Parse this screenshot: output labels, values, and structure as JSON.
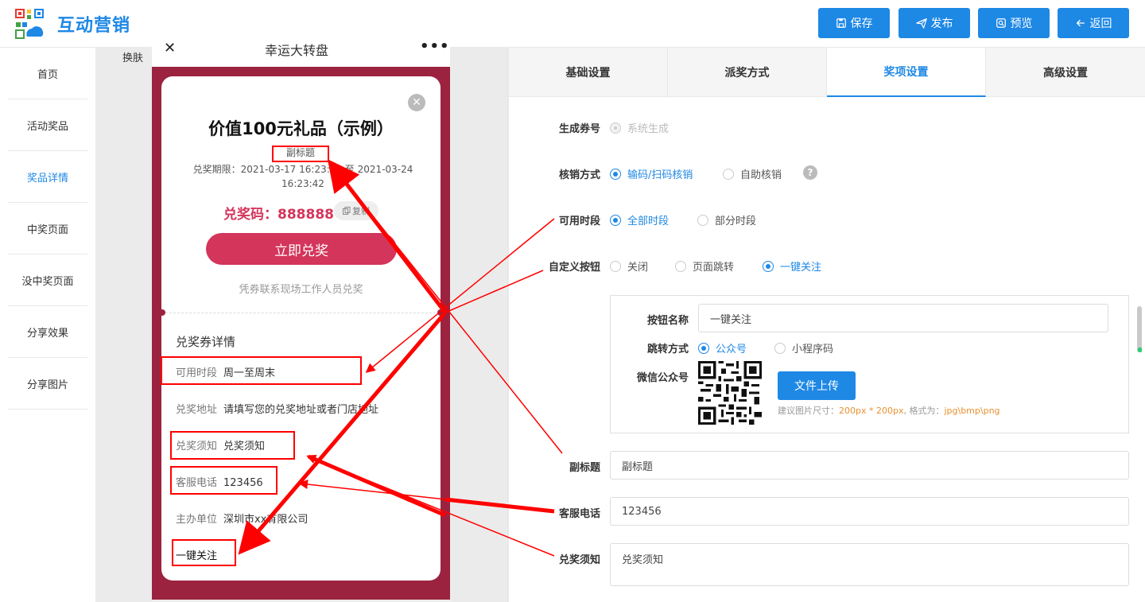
{
  "header": {
    "brand": "互动营销",
    "buttons": [
      {
        "label": "保存",
        "icon": "save-icon"
      },
      {
        "label": "发布",
        "icon": "send-icon"
      },
      {
        "label": "预览",
        "icon": "preview-icon"
      },
      {
        "label": "返回",
        "icon": "arrow-left-icon"
      }
    ]
  },
  "sidebar": {
    "items": [
      {
        "label": "首页"
      },
      {
        "label": "活动奖品"
      },
      {
        "label": "奖品详情",
        "active": true
      },
      {
        "label": "中奖页面"
      },
      {
        "label": "没中奖页面"
      },
      {
        "label": "分享效果"
      },
      {
        "label": "分享图片"
      }
    ]
  },
  "preview": {
    "skin_label": "换肤",
    "phone_title": "幸运大转盘",
    "close_glyph": "✕",
    "more_glyph": "•••",
    "card": {
      "close_glyph": "✕",
      "title": "价值100元礼品（示例）",
      "subtitle": "副标题",
      "period": "兑奖期限：2021-03-17 16:23:42 至 2021-03-24 16:23:42",
      "code_label": "兑奖码：888888",
      "copy_label": "复制",
      "redeem_button": "立即兑奖",
      "redeem_note": "凭券联系现场工作人员兑奖",
      "detail_title": "兑奖券详情",
      "details": [
        {
          "key": "可用时段",
          "value": "周一至周末"
        },
        {
          "key": "兑奖地址",
          "value": "请填写您的兑奖地址或者门店地址"
        },
        {
          "key": "兑奖须知",
          "value": "兑奖须知"
        },
        {
          "key": "客服电话",
          "value": "123456"
        },
        {
          "key": "主办单位",
          "value": "深圳市xx有限公司"
        }
      ],
      "follow_button": "一键关注"
    }
  },
  "tabs": [
    {
      "label": "基础设置"
    },
    {
      "label": "派奖方式"
    },
    {
      "label": "奖项设置",
      "active": true
    },
    {
      "label": "高级设置"
    }
  ],
  "form": {
    "coupon": {
      "label": "生成券号",
      "option": "系统生成"
    },
    "verify": {
      "label": "核销方式",
      "options": [
        "输码/扫码核销",
        "自助核销"
      ],
      "selected": "输码/扫码核销",
      "help": "?"
    },
    "period": {
      "label": "可用时段",
      "options": [
        "全部时段",
        "部分时段"
      ],
      "selected": "全部时段"
    },
    "custom_button": {
      "label": "自定义按钮",
      "options": [
        "关闭",
        "页面跳转",
        "一键关注"
      ],
      "selected": "一键关注"
    },
    "button_name": {
      "label": "按钮名称",
      "value": "一键关注"
    },
    "jump_mode": {
      "label": "跳转方式",
      "options": [
        "公众号",
        "小程序码"
      ],
      "selected": "公众号"
    },
    "wechat": {
      "label": "微信公众号",
      "upload": "文件上传",
      "hint_prefix": "建议图片尺寸：",
      "hint_size": "200px * 200px",
      "hint_mid": ", 格式为：",
      "hint_format": "jpg\\bmp\\png"
    },
    "subtitle": {
      "label": "副标题",
      "value": "副标题"
    },
    "phone": {
      "label": "客服电话",
      "value": "123456"
    },
    "notice": {
      "label": "兑奖须知",
      "value": "兑奖须知"
    }
  },
  "colors": {
    "accent": "#1E88E5",
    "phone_bg": "#9b2340",
    "prize_red": "#d4355b",
    "annotation": "#ff0000"
  }
}
